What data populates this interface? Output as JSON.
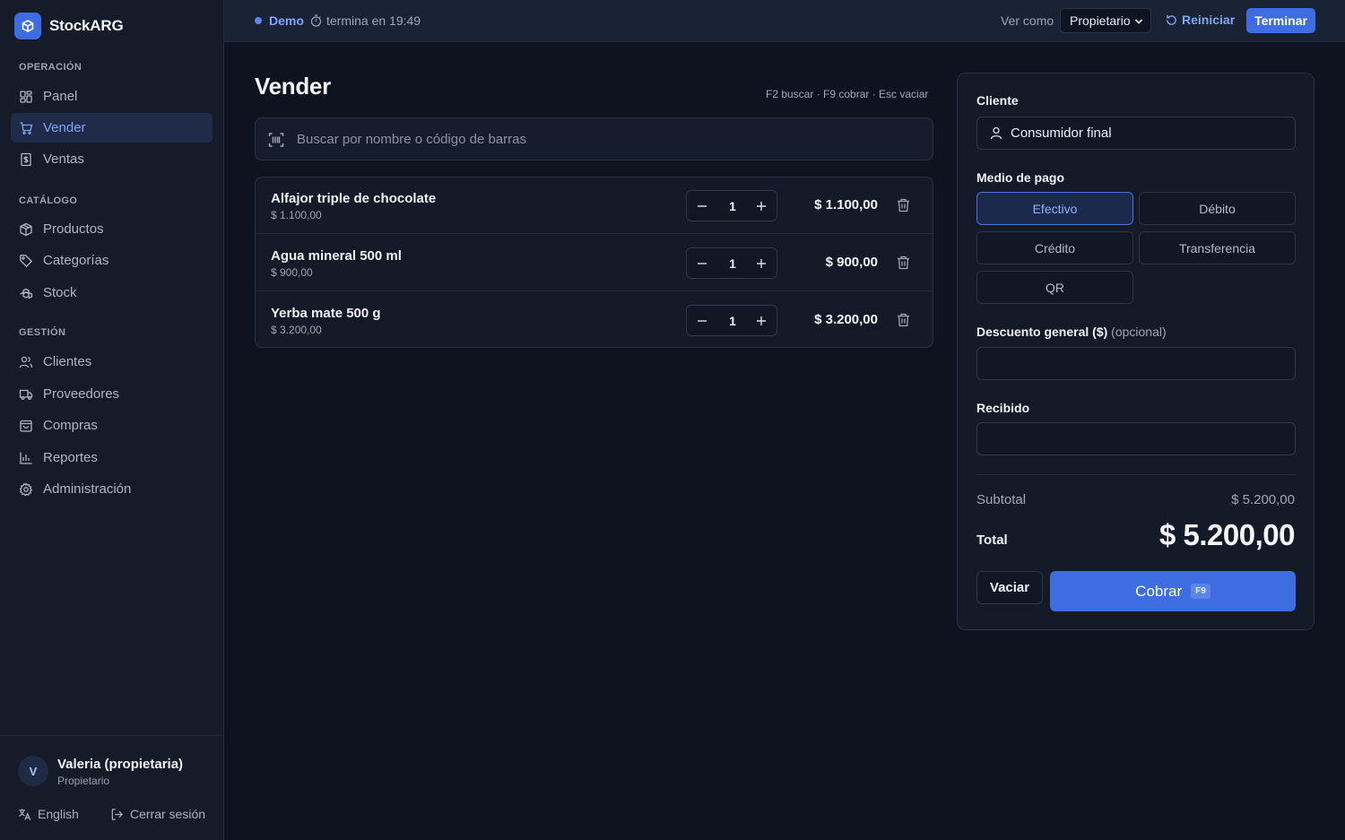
{
  "brand": {
    "name": "StockARG"
  },
  "sidebar": {
    "sections": [
      {
        "label": "OPERACIÓN"
      },
      {
        "label": "CATÁLOGO"
      },
      {
        "label": "GESTIÓN"
      }
    ],
    "items": [
      {
        "label": "Panel",
        "icon": "dashboard-icon"
      },
      {
        "label": "Vender",
        "icon": "cart-icon",
        "active": true
      },
      {
        "label": "Ventas",
        "icon": "receipt-icon"
      },
      {
        "label": "Productos",
        "icon": "box-icon"
      },
      {
        "label": "Categorías",
        "icon": "tag-icon"
      },
      {
        "label": "Stock",
        "icon": "boxes-icon"
      },
      {
        "label": "Clientes",
        "icon": "users-icon"
      },
      {
        "label": "Proveedores",
        "icon": "truck-icon"
      },
      {
        "label": "Compras",
        "icon": "shopping-bag-icon"
      },
      {
        "label": "Reportes",
        "icon": "bar-chart-icon"
      },
      {
        "label": "Administración",
        "icon": "gear-icon"
      }
    ],
    "user": {
      "initial": "V",
      "name": "Valeria (propietaria)",
      "role": "Propietario"
    },
    "language": "English",
    "logout": "Cerrar sesión"
  },
  "topbar": {
    "demo": "Demo",
    "timer": "termina en 19:49",
    "view_as_label": "Ver como",
    "view_as_value": "Propietario",
    "reset": "Reiniciar",
    "end": "Terminar"
  },
  "main": {
    "title": "Vender",
    "shortcuts": "F2 buscar · F9 cobrar · Esc vaciar",
    "search_placeholder": "Buscar por nombre o código de barras",
    "cart": [
      {
        "name": "Alfajor triple de chocolate",
        "unit_price": "$ 1.100,00",
        "qty": "1",
        "total": "$ 1.100,00"
      },
      {
        "name": "Agua mineral 500 ml",
        "unit_price": "$ 900,00",
        "qty": "1",
        "total": "$ 900,00"
      },
      {
        "name": "Yerba mate 500 g",
        "unit_price": "$ 3.200,00",
        "qty": "1",
        "total": "$ 3.200,00"
      }
    ]
  },
  "checkout": {
    "client_label": "Cliente",
    "client_value": "Consumidor final",
    "payment_label": "Medio de pago",
    "payment_methods": [
      "Efectivo",
      "Débito",
      "Crédito",
      "Transferencia",
      "QR"
    ],
    "payment_selected": "Efectivo",
    "discount_label": "Descuento general ($)",
    "discount_optional": "(opcional)",
    "received_label": "Recibido",
    "subtotal_label": "Subtotal",
    "subtotal_value": "$ 5.200,00",
    "total_label": "Total",
    "total_value": "$ 5.200,00",
    "clear_button": "Vaciar",
    "charge_button": "Cobrar",
    "charge_shortcut": "F9"
  },
  "colors": {
    "accent": "#3d6de0",
    "background": "#0f1320",
    "sidebar": "#161b2a"
  }
}
